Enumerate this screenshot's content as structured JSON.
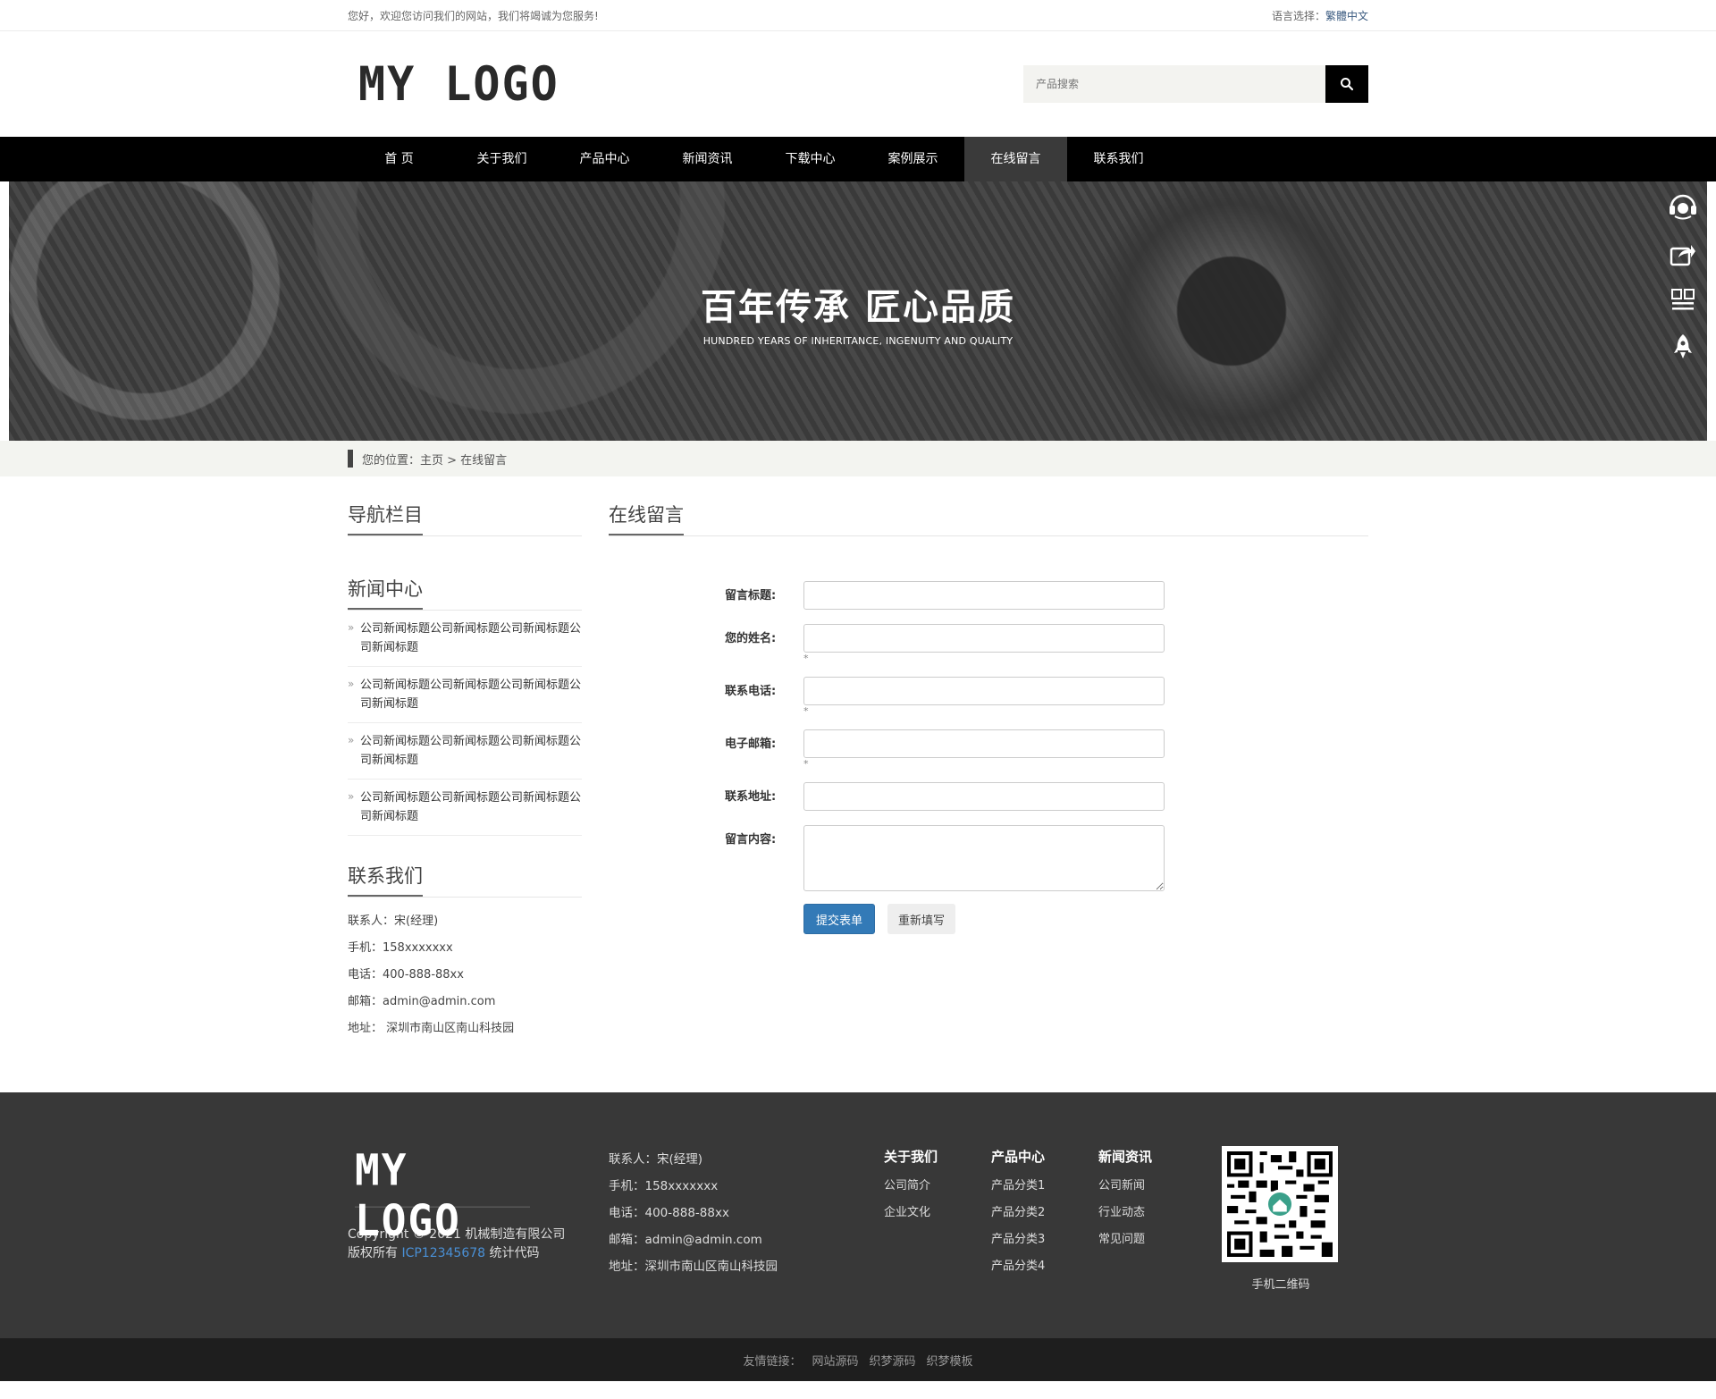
{
  "topbar": {
    "welcome": "您好，欢迎您访问我们的网站，我们将竭诚为您服务!",
    "lang_label": "语言选择：",
    "lang_link": "繁體中文"
  },
  "header": {
    "logo": "MY LOGO",
    "search_placeholder": "产品搜索"
  },
  "nav": {
    "items": [
      {
        "label": "首 页"
      },
      {
        "label": "关于我们"
      },
      {
        "label": "产品中心"
      },
      {
        "label": "新闻资讯"
      },
      {
        "label": "下载中心"
      },
      {
        "label": "案例展示"
      },
      {
        "label": "在线留言"
      },
      {
        "label": "联系我们"
      }
    ]
  },
  "banner": {
    "title": "百年传承 匠心品质",
    "subtitle": "HUNDRED YEARS OF INHERITANCE, INGENUITY AND QUALITY"
  },
  "breadcrumb": {
    "text": "您的位置：主页 > 在线留言"
  },
  "sidebar": {
    "nav_title": "导航栏目",
    "news_title": "新闻中心",
    "news": [
      "公司新闻标题公司新闻标题公司新闻标题公司新闻标题",
      "公司新闻标题公司新闻标题公司新闻标题公司新闻标题",
      "公司新闻标题公司新闻标题公司新闻标题公司新闻标题",
      "公司新闻标题公司新闻标题公司新闻标题公司新闻标题"
    ],
    "contact_title": "联系我们",
    "contact": [
      "联系人：宋(经理)",
      "手机：158xxxxxxx",
      "电话：400-888-88xx",
      "邮箱：admin@admin.com",
      "地址： 深圳市南山区南山科技园"
    ]
  },
  "form": {
    "title": "在线留言",
    "fields": [
      {
        "label": "留言标题:"
      },
      {
        "label": "您的姓名:",
        "hint": "*"
      },
      {
        "label": "联系电话:",
        "hint": "*"
      },
      {
        "label": "电子邮箱:",
        "hint": "*"
      },
      {
        "label": "联系地址:"
      },
      {
        "label": "留言内容:"
      }
    ],
    "submit": "提交表单",
    "reset": "重新填写"
  },
  "footer": {
    "logo": "MY LOGO",
    "copy_a": "Copyright © 2021 机械制造有限公司 版权所有 ",
    "icp": "ICP12345678",
    "copy_b": " 统计代码",
    "contact": [
      "联系人：宋(经理)",
      "手机：158xxxxxxx",
      "电话：400-888-88xx",
      "邮箱：admin@admin.com",
      "地址：深圳市南山区南山科技园"
    ],
    "cols": [
      {
        "title": "关于我们",
        "items": [
          "公司简介",
          "企业文化"
        ]
      },
      {
        "title": "产品中心",
        "items": [
          "产品分类1",
          "产品分类2",
          "产品分类3",
          "产品分类4"
        ]
      },
      {
        "title": "新闻资讯",
        "items": [
          "公司新闻",
          "行业动态",
          "常见问题"
        ]
      }
    ],
    "qr_caption": "手机二维码"
  },
  "links": {
    "label": "友情链接：",
    "items": [
      "网站源码",
      "织梦源码",
      "织梦模板"
    ]
  }
}
